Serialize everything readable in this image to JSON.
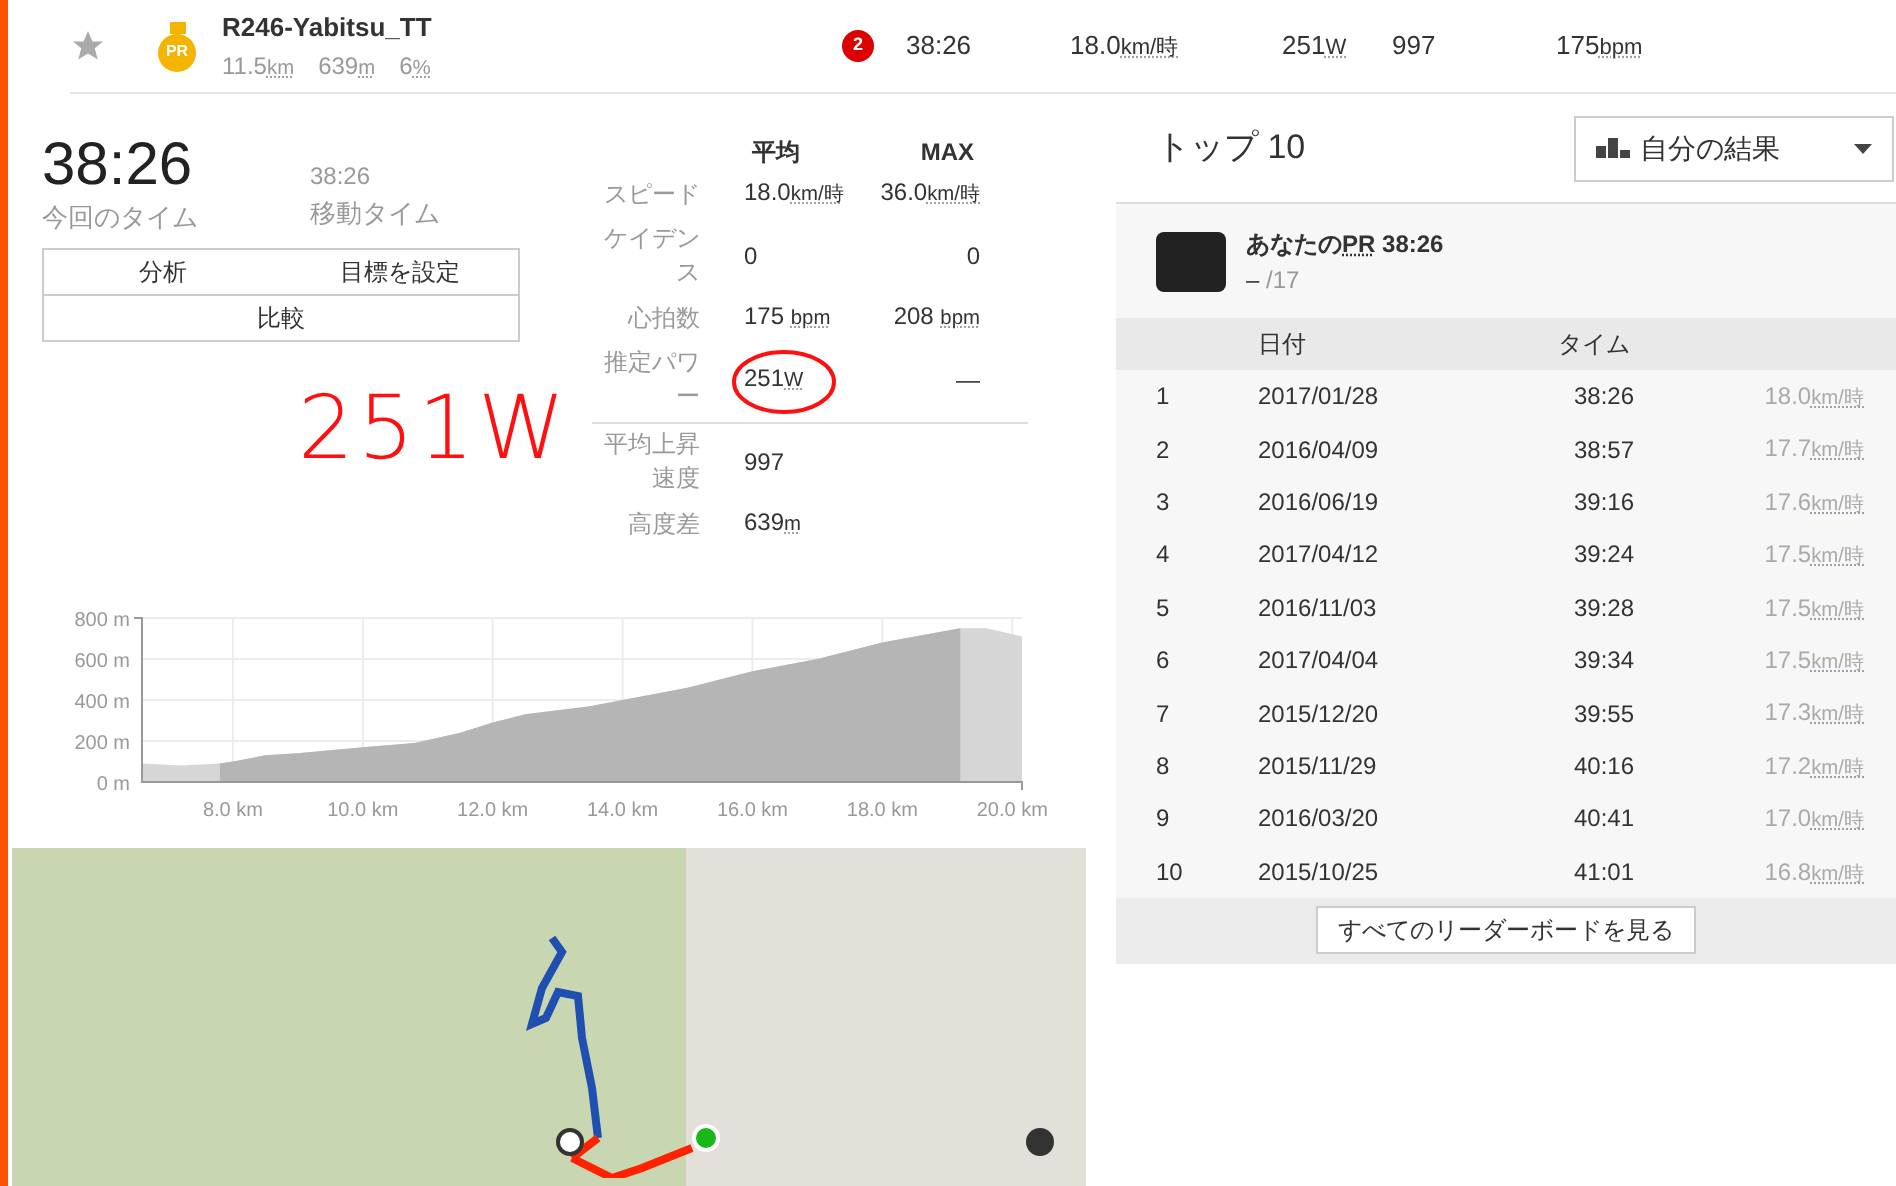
{
  "segment": {
    "starred": false,
    "pr_badge": "PR",
    "name": "R246-Yabitsu_TT",
    "stats": [
      {
        "value": "11.5",
        "unit": "km"
      },
      {
        "value": "639",
        "unit": "m"
      },
      {
        "value": "6",
        "unit": "%"
      }
    ],
    "rank_badge": "2",
    "time": "38:26",
    "speed": {
      "value": "18.0",
      "unit": "km/時"
    },
    "power": {
      "value": "251",
      "unit": "W"
    },
    "climb": "997",
    "heart_rate": {
      "value": "175",
      "unit": "bpm"
    }
  },
  "summary": {
    "elapsed": {
      "value": "38:26",
      "label": "今回のタイム"
    },
    "moving": {
      "value": "38:26",
      "label": "移動タイム"
    },
    "buttons": [
      {
        "label": "分析"
      },
      {
        "label": "目標を設定"
      },
      {
        "label": "比較"
      }
    ],
    "annotation": "251W"
  },
  "stats": {
    "columns": [
      "平均",
      "MAX"
    ],
    "rows": [
      {
        "label": "スピード",
        "avg": {
          "value": "18.0",
          "unit": "km/時"
        },
        "max": {
          "value": "36.0",
          "unit": "km/時"
        },
        "circled": false,
        "divider_before": false
      },
      {
        "label": "ケイデンス",
        "avg": {
          "value": "0"
        },
        "max": {
          "value": "0"
        },
        "circled": false,
        "divider_before": false
      },
      {
        "label": "心拍数",
        "avg": {
          "value": "175 ",
          "unit": "bpm"
        },
        "max": {
          "value": "208 ",
          "unit": "bpm"
        },
        "circled": false,
        "divider_before": false
      },
      {
        "label": "推定パワー",
        "avg": {
          "value": "251",
          "unit": "W"
        },
        "max": {
          "value": "—"
        },
        "circled": true,
        "divider_before": false
      },
      {
        "label": "平均上昇速度",
        "avg": {
          "value": "997"
        },
        "circled": false,
        "divider_before": true
      },
      {
        "label": "高度差",
        "avg": {
          "value": "639",
          "unit": "m"
        },
        "circled": false,
        "divider_before": false
      }
    ]
  },
  "elevation": {
    "chart_data": {
      "type": "area",
      "x": [
        6.6,
        7.2,
        7.8,
        8.0,
        8.5,
        9.0,
        10.0,
        10.8,
        11.5,
        12.0,
        12.5,
        13.5,
        14.0,
        15.0,
        16.0,
        17.0,
        18.0,
        18.5,
        19.2,
        19.6,
        20.15
      ],
      "grid": true,
      "series": [
        {
          "color": "#d6d6d6",
          "values": [
            90,
            80,
            90,
            100,
            130,
            140,
            170,
            190,
            240,
            290,
            330,
            370,
            400,
            460,
            540,
            600,
            680,
            710,
            750,
            750,
            710
          ]
        },
        {
          "color": "#b5b5b5",
          "values": [
            null,
            null,
            90,
            100,
            130,
            140,
            170,
            190,
            240,
            290,
            330,
            370,
            400,
            460,
            540,
            600,
            680,
            710,
            750,
            null,
            null
          ]
        }
      ],
      "xlim": [
        6.6,
        20.15
      ],
      "ylim": [
        0,
        800
      ],
      "xticks": [
        {
          "value": 8,
          "label": "8.0 km"
        },
        {
          "value": 10,
          "label": "10.0 km"
        },
        {
          "value": 12,
          "label": "12.0 km"
        },
        {
          "value": 14,
          "label": "14.0 km"
        },
        {
          "value": 16,
          "label": "16.0 km"
        },
        {
          "value": 18,
          "label": "18.0 km"
        },
        {
          "value": 20,
          "label": "20.0 km"
        }
      ],
      "yticks": [
        {
          "value": 0,
          "label": "0 m"
        },
        {
          "value": 200,
          "label": "200 m"
        },
        {
          "value": 400,
          "label": "400 m"
        },
        {
          "value": 600,
          "label": "600 m"
        },
        {
          "value": 800,
          "label": "800 m"
        }
      ]
    }
  },
  "leaderboard": {
    "title": "トップ 10",
    "filter": "自分の結果",
    "pr": {
      "label": "あなたの",
      "abbr": "PR",
      "time": "38:26",
      "rank": "–",
      "total": "/17"
    },
    "columns": [
      "日付",
      "タイム"
    ],
    "rows": [
      {
        "rank": "1",
        "date": "2017/01/28",
        "time": "38:26",
        "speed": {
          "value": "18.0",
          "unit": "km/時"
        }
      },
      {
        "rank": "2",
        "date": "2016/04/09",
        "time": "38:57",
        "speed": {
          "value": "17.7",
          "unit": "km/時"
        }
      },
      {
        "rank": "3",
        "date": "2016/06/19",
        "time": "39:16",
        "speed": {
          "value": "17.6",
          "unit": "km/時"
        }
      },
      {
        "rank": "4",
        "date": "2017/04/12",
        "time": "39:24",
        "speed": {
          "value": "17.5",
          "unit": "km/時"
        }
      },
      {
        "rank": "5",
        "date": "2016/11/03",
        "time": "39:28",
        "speed": {
          "value": "17.5",
          "unit": "km/時"
        }
      },
      {
        "rank": "6",
        "date": "2017/04/04",
        "time": "39:34",
        "speed": {
          "value": "17.5",
          "unit": "km/時"
        }
      },
      {
        "rank": "7",
        "date": "2015/12/20",
        "time": "39:55",
        "speed": {
          "value": "17.3",
          "unit": "km/時"
        }
      },
      {
        "rank": "8",
        "date": "2015/11/29",
        "time": "40:16",
        "speed": {
          "value": "17.2",
          "unit": "km/時"
        }
      },
      {
        "rank": "9",
        "date": "2016/03/20",
        "time": "40:41",
        "speed": {
          "value": "17.0",
          "unit": "km/時"
        }
      },
      {
        "rank": "10",
        "date": "2015/10/25",
        "time": "41:01",
        "speed": {
          "value": "16.8",
          "unit": "km/時"
        }
      }
    ],
    "footer_button": "すべてのリーダーボードを見る"
  }
}
